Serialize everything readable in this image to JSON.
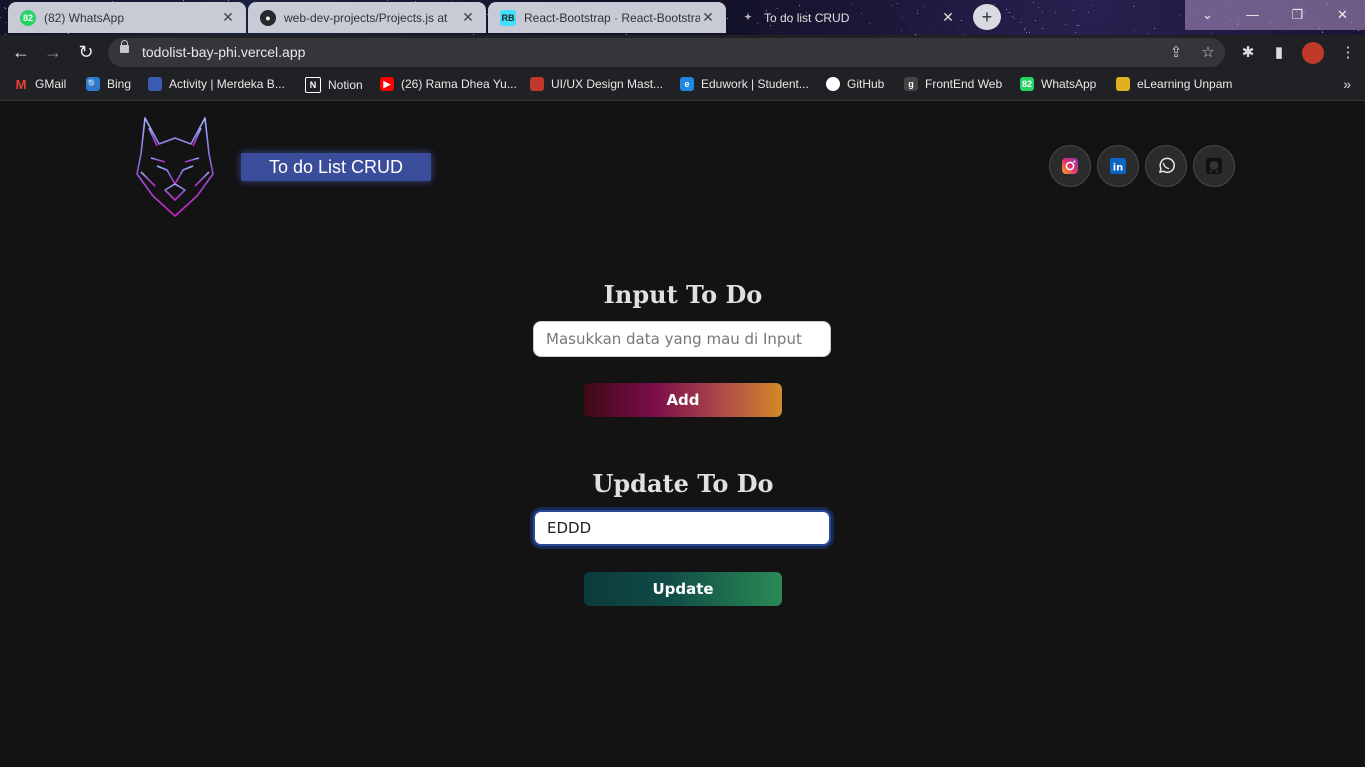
{
  "browser": {
    "tabs": [
      {
        "label": "(82) WhatsApp",
        "icon": "whatsapp-icon",
        "icon_text": "82",
        "active": false
      },
      {
        "label": "web-dev-projects/Projects.js at ",
        "icon": "github-icon",
        "active": false
      },
      {
        "label": "React-Bootstrap · React-Bootstrap",
        "icon": "react-bootstrap-icon",
        "icon_text": "RB",
        "active": false
      },
      {
        "label": "To do list CRUD",
        "icon": "page-icon",
        "active": true
      }
    ],
    "new_tab": "+",
    "url": "todolist-bay-phi.vercel.app",
    "bookmarks": [
      {
        "label": "GMail",
        "icon": "gmail-icon",
        "icon_text": "M",
        "color": "#ea4335"
      },
      {
        "label": "Bing",
        "icon": "bing-search-icon",
        "icon_text": "🔍",
        "color": "#2b79d6"
      },
      {
        "label": "Activity | Merdeka B...",
        "icon": "merdeka-icon",
        "icon_text": "",
        "color": "#3b5bb5"
      },
      {
        "label": "Notion",
        "icon": "notion-icon",
        "icon_text": "N",
        "color": "#ffffff"
      },
      {
        "label": "(26) Rama Dhea Yu...",
        "icon": "youtube-icon",
        "icon_text": "▶",
        "color": "#ff0000"
      },
      {
        "label": "UI/UX Design Mast...",
        "icon": "udemy-icon",
        "icon_text": "",
        "color": "#c0392b"
      },
      {
        "label": "Eduwork | Student...",
        "icon": "eduwork-icon",
        "icon_text": "e",
        "color": "#1e88e5"
      },
      {
        "label": "GitHub",
        "icon": "github-icon",
        "icon_text": "",
        "color": "#ffffff"
      },
      {
        "label": "FrontEnd Web",
        "icon": "frontend-icon",
        "icon_text": "g",
        "color": "#444444"
      },
      {
        "label": "WhatsApp",
        "icon": "whatsapp-icon",
        "icon_text": "82",
        "color": "#25d366"
      },
      {
        "label": "eLearning Unpam",
        "icon": "elearning-icon",
        "icon_text": "",
        "color": "#e0b020"
      }
    ]
  },
  "header": {
    "brand": "To do List CRUD",
    "socials": [
      {
        "name": "instagram-icon",
        "color": "#e1306c"
      },
      {
        "name": "linkedin-icon",
        "color": "#0a66c2"
      },
      {
        "name": "whatsapp-icon",
        "color": "#e8e8e8"
      },
      {
        "name": "github-icon",
        "color": "#111111"
      }
    ]
  },
  "input_section": {
    "title": "Input To Do",
    "placeholder": "Masukkan data yang mau di Input",
    "value": "",
    "button": "Add"
  },
  "update_section": {
    "title": "Update To Do",
    "value": "EDDD",
    "button": "Update"
  }
}
